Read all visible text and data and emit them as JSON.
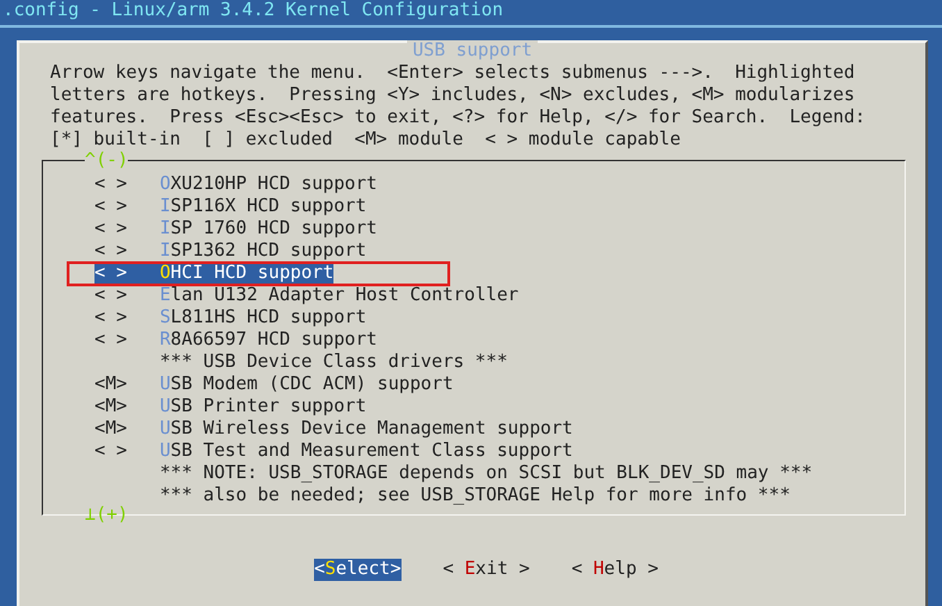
{
  "window": {
    "title": ".config - Linux/arm 3.4.2 Kernel Configuration"
  },
  "dialog": {
    "title": "USB support",
    "help_text": [
      "Arrow keys navigate the menu.  <Enter> selects submenus --->.  Highlighted",
      "letters are hotkeys.  Pressing <Y> includes, <N> excludes, <M> modularizes",
      "features.  Press <Esc><Esc> to exit, <?> for Help, </> for Search.  Legend:",
      "[*] built-in  [ ] excluded  <M> module  < > module capable"
    ],
    "scroll_up": "^(-)",
    "items": [
      {
        "kind": "option",
        "prefix": "< >",
        "label": "OXU210HP HCD support",
        "selected": false,
        "boxed": false
      },
      {
        "kind": "option",
        "prefix": "< >",
        "label": "ISP116X HCD support",
        "selected": false,
        "boxed": false
      },
      {
        "kind": "option",
        "prefix": "< >",
        "label": "ISP 1760 HCD support",
        "selected": false,
        "boxed": false
      },
      {
        "kind": "option",
        "prefix": "< >",
        "label": "ISP1362 HCD support",
        "selected": false,
        "boxed": false
      },
      {
        "kind": "option",
        "prefix": "< >",
        "label": "OHCI HCD support",
        "selected": true,
        "boxed": true
      },
      {
        "kind": "option",
        "prefix": "< >",
        "label": "Elan U132 Adapter Host Controller",
        "selected": false,
        "boxed": false
      },
      {
        "kind": "option",
        "prefix": "< >",
        "label": "SL811HS HCD support",
        "selected": false,
        "boxed": false
      },
      {
        "kind": "option",
        "prefix": "< >",
        "label": "R8A66597 HCD support",
        "selected": false,
        "boxed": false
      },
      {
        "kind": "comment",
        "label": "*** USB Device Class drivers ***",
        "selected": false,
        "boxed": false
      },
      {
        "kind": "option",
        "prefix": "<M>",
        "label": "USB Modem (CDC ACM) support",
        "selected": false,
        "boxed": false
      },
      {
        "kind": "option",
        "prefix": "<M>",
        "label": "USB Printer support",
        "selected": false,
        "boxed": false
      },
      {
        "kind": "option",
        "prefix": "<M>",
        "label": "USB Wireless Device Management support",
        "selected": false,
        "boxed": false
      },
      {
        "kind": "option",
        "prefix": "< >",
        "label": "USB Test and Measurement Class support",
        "selected": false,
        "boxed": false
      },
      {
        "kind": "comment",
        "label": "*** NOTE: USB_STORAGE depends on SCSI but BLK_DEV_SD may ***",
        "selected": false,
        "boxed": false
      },
      {
        "kind": "comment",
        "label": "*** also be needed; see USB_STORAGE Help for more info ***",
        "selected": false,
        "boxed": false
      }
    ],
    "scroll_down": "⊥(+)",
    "buttons": [
      {
        "label": "<Select>",
        "selected": true
      },
      {
        "label": "< Exit >",
        "selected": false
      },
      {
        "label": "< Help >",
        "selected": false
      }
    ]
  }
}
